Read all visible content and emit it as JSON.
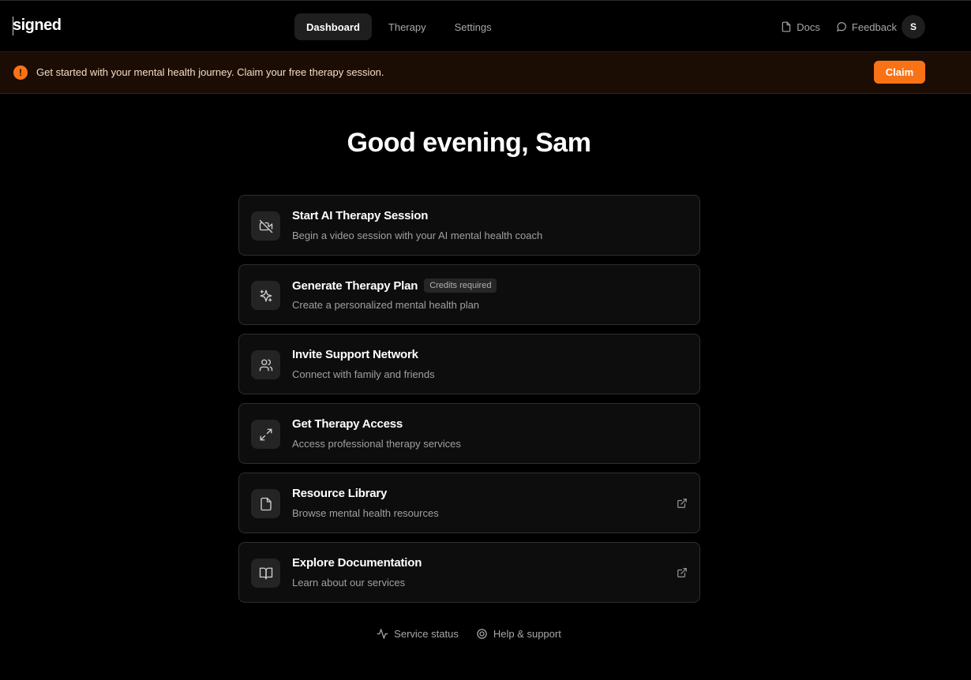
{
  "header": {
    "logo": "signed",
    "nav": [
      {
        "label": "Dashboard",
        "active": true
      },
      {
        "label": "Therapy",
        "active": false
      },
      {
        "label": "Settings",
        "active": false
      }
    ],
    "docs_label": "Docs",
    "feedback_label": "Feedback",
    "avatar_initial": "S"
  },
  "banner": {
    "icon": "!",
    "message": "Get started with your mental health journey. Claim your free therapy session.",
    "button_label": "Claim",
    "accent_color": "#f97316"
  },
  "greeting": "Good evening, Sam",
  "cards": [
    {
      "icon": "video-off-icon",
      "title": "Start AI Therapy Session",
      "description": "Begin a video session with your AI mental health coach",
      "badge": "",
      "external": false
    },
    {
      "icon": "sparkles-icon",
      "title": "Generate Therapy Plan",
      "description": "Create a personalized mental health plan",
      "badge": "Credits required",
      "external": false
    },
    {
      "icon": "users-icon",
      "title": "Invite Support Network",
      "description": "Connect with family and friends",
      "badge": "",
      "external": false
    },
    {
      "icon": "expand-arrows-icon",
      "title": "Get Therapy Access",
      "description": "Access professional therapy services",
      "badge": "",
      "external": false
    },
    {
      "icon": "file-icon",
      "title": "Resource Library",
      "description": "Browse mental health resources",
      "badge": "",
      "external": true
    },
    {
      "icon": "book-open-icon",
      "title": "Explore Documentation",
      "description": "Learn about our services",
      "badge": "",
      "external": true
    }
  ],
  "footer": {
    "service_status_label": "Service status",
    "help_label": "Help & support"
  }
}
